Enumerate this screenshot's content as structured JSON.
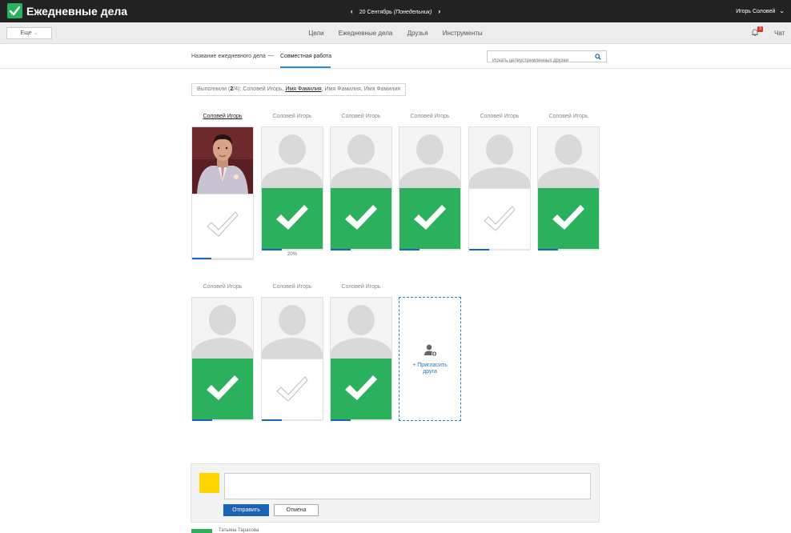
{
  "app": {
    "title": "Ежедневные дела",
    "accent": "#2bb05d",
    "brand_dark": "#222222"
  },
  "date_nav": {
    "date": "20 Сентябрь",
    "weekday": "(Понедельник)",
    "prev_icon": "chevron-left-icon",
    "next_icon": "chevron-right-icon"
  },
  "user": {
    "name": "Игорь Соловей"
  },
  "toolbar": {
    "more_label": "Еще",
    "notifications_count": "3",
    "chat_label": "Чат"
  },
  "nav": {
    "items": [
      "Цели",
      "Ежедневные дела",
      "Друзья",
      "Инструменты"
    ]
  },
  "breadcrumb": {
    "parent": "Название ежедневного дела",
    "separator": "—",
    "current": "Совместная работа"
  },
  "search": {
    "placeholder": "Искать целеустремленных друзей"
  },
  "done_summary": {
    "prefix": "Выполнили (",
    "count": "2",
    "suffix": "/4): Соловей Игорь, ",
    "highlight": "Имя Фамилия",
    "rest": ", Имя Фамилия, Имя Фамилия"
  },
  "participants": [
    {
      "name": "Соловей Игорь",
      "status": "pending",
      "progress": 0.32,
      "has_photo": true,
      "active": true
    },
    {
      "name": "Соловей Игорь",
      "status": "done",
      "progress": 0.33,
      "percent_label": "20%"
    },
    {
      "name": "Соловей Игорь",
      "status": "done",
      "progress": 0.33
    },
    {
      "name": "Соловей Игорь",
      "status": "done",
      "progress": 0.33
    },
    {
      "name": "Соловей Игорь",
      "status": "pending",
      "progress": 0.33
    },
    {
      "name": "Соловей Игорь",
      "status": "done",
      "progress": 0.33
    },
    {
      "name": "Соловей Игорь",
      "status": "done",
      "progress": 0.33
    },
    {
      "name": "Соловей Игорь",
      "status": "pending",
      "progress": 0.33
    },
    {
      "name": "Соловей Игорь",
      "status": "done",
      "progress": 0.33
    }
  ],
  "invite": {
    "label_line1": "+ Пригласить",
    "label_line2": "друга"
  },
  "comment": {
    "send_label": "Отправить",
    "cancel_label": "Отмена"
  },
  "footer": {
    "author": "Татьяна Тарасова"
  }
}
